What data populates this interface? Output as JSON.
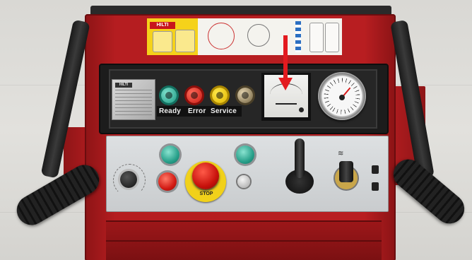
{
  "warning_labels": {
    "brand": "HILTI",
    "colors": {
      "yellow": "#f5d21a",
      "white": "#f4f3ee",
      "blue": "#2b6fc2"
    }
  },
  "rating_plate": {
    "brand": "HILTI"
  },
  "status_indicators": [
    {
      "label": "Ready",
      "color": "#1e9a84"
    },
    {
      "label": "Error",
      "color": "#c81a14"
    },
    {
      "label": "Service",
      "color": "#e0b400"
    }
  ],
  "emergency_stop": {
    "label": "STOP",
    "color": "#c8120c",
    "base_color": "#f1d11a"
  },
  "arrow": {
    "color": "#e31a1f"
  },
  "machine": {
    "body_color": "#b51d20",
    "handle_color": "#1a1a1a"
  }
}
